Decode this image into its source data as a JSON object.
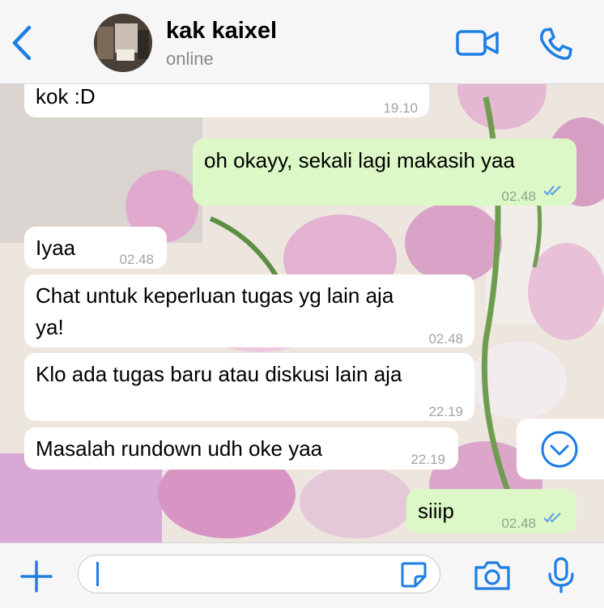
{
  "header": {
    "contact_name": "kak kaixel",
    "status": "online"
  },
  "icons": {
    "back": "chevron-left",
    "video": "video-camera",
    "phone": "phone",
    "add": "plus",
    "sticker": "sticker",
    "camera": "camera",
    "mic": "microphone",
    "scroll": "chevron-down-circle"
  },
  "colors": {
    "accent": "#1d7ee3",
    "outgoing_bubble": "#dcf8c6",
    "incoming_bubble": "#ffffff"
  },
  "messages": [
    {
      "direction": "in",
      "text": "kok :D",
      "time": "19.10"
    },
    {
      "direction": "out",
      "text": "oh okayy, sekali lagi makasih yaa",
      "time": "02.48",
      "read": true
    },
    {
      "direction": "in",
      "text": "Iyaa",
      "time": "02.48"
    },
    {
      "direction": "in",
      "text_line1": "Chat untuk keperluan tugas yg lain aja",
      "text_line2": "ya!",
      "time": "02.48"
    },
    {
      "direction": "in",
      "text": "Klo ada tugas baru atau diskusi lain aja",
      "time": "22.19"
    },
    {
      "direction": "in",
      "text": "Masalah rundown udh oke yaa",
      "time": "22.19"
    },
    {
      "direction": "out",
      "text": "siiip",
      "time": "02.48",
      "read": true
    }
  ],
  "input": {
    "value": ""
  }
}
